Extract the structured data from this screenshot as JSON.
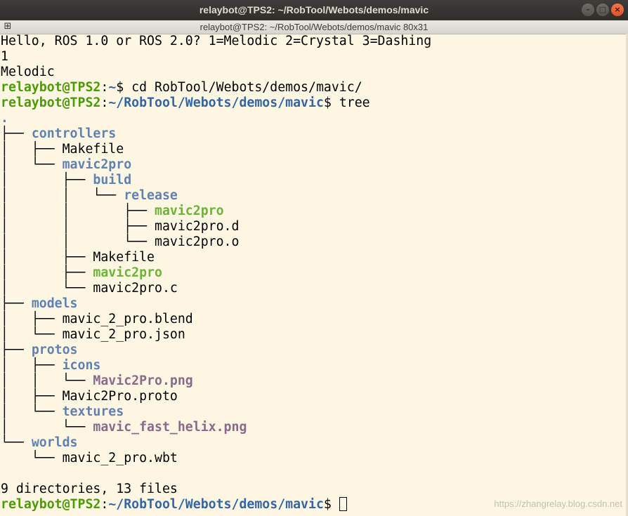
{
  "window": {
    "title": "relaybot@TPS2: ~/RobTool/Webots/demos/mavic",
    "tab_title": "relaybot@TPS2: ~/RobTool/Webots/demos/mavic 80x31",
    "minimize_glyph": "–",
    "maximize_glyph": "□",
    "close_glyph": "×"
  },
  "colors": {
    "background": "#fdf6e3",
    "prompt_user": "#4e9a06",
    "prompt_path": "#3465a4",
    "directory": "#5f81b3",
    "executable": "#6eb23a",
    "image_file": "#8a6a8a"
  },
  "terminal": {
    "lines": [
      [
        {
          "t": "Hello, ROS 1.0 or ROS 2.0? 1=Melodic 2=Crystal 3=Dashing",
          "c": ""
        }
      ],
      [
        {
          "t": "1",
          "c": ""
        }
      ],
      [
        {
          "t": "Melodic",
          "c": ""
        }
      ],
      [
        {
          "t": "relaybot@TPS2",
          "c": "prompt-user"
        },
        {
          "t": ":",
          "c": ""
        },
        {
          "t": "~",
          "c": "prompt-path"
        },
        {
          "t": "$ cd RobTool/Webots/demos/mavic/",
          "c": ""
        }
      ],
      [
        {
          "t": "relaybot@TPS2",
          "c": "prompt-user"
        },
        {
          "t": ":",
          "c": ""
        },
        {
          "t": "~/RobTool/Webots/demos/mavic",
          "c": "prompt-path"
        },
        {
          "t": "$ tree",
          "c": ""
        }
      ],
      [
        {
          "t": ".",
          "c": "dir"
        }
      ],
      [
        {
          "t": "├── ",
          "c": "tree-pre"
        },
        {
          "t": "controllers",
          "c": "dir"
        }
      ],
      [
        {
          "t": "│   ├── ",
          "c": "tree-pre"
        },
        {
          "t": "Makefile",
          "c": ""
        }
      ],
      [
        {
          "t": "│   └── ",
          "c": "tree-pre"
        },
        {
          "t": "mavic2pro",
          "c": "dir"
        }
      ],
      [
        {
          "t": "│       ├── ",
          "c": "tree-pre"
        },
        {
          "t": "build",
          "c": "dir"
        }
      ],
      [
        {
          "t": "│       │   └── ",
          "c": "tree-pre"
        },
        {
          "t": "release",
          "c": "dir"
        }
      ],
      [
        {
          "t": "│       │       ├── ",
          "c": "tree-pre"
        },
        {
          "t": "mavic2pro",
          "c": "exe"
        }
      ],
      [
        {
          "t": "│       │       ├── ",
          "c": "tree-pre"
        },
        {
          "t": "mavic2pro.d",
          "c": ""
        }
      ],
      [
        {
          "t": "│       │       └── ",
          "c": "tree-pre"
        },
        {
          "t": "mavic2pro.o",
          "c": ""
        }
      ],
      [
        {
          "t": "│       ├── ",
          "c": "tree-pre"
        },
        {
          "t": "Makefile",
          "c": ""
        }
      ],
      [
        {
          "t": "│       ├── ",
          "c": "tree-pre"
        },
        {
          "t": "mavic2pro",
          "c": "exe"
        }
      ],
      [
        {
          "t": "│       └── ",
          "c": "tree-pre"
        },
        {
          "t": "mavic2pro.c",
          "c": ""
        }
      ],
      [
        {
          "t": "├── ",
          "c": "tree-pre"
        },
        {
          "t": "models",
          "c": "dir"
        }
      ],
      [
        {
          "t": "│   ├── ",
          "c": "tree-pre"
        },
        {
          "t": "mavic_2_pro.blend",
          "c": ""
        }
      ],
      [
        {
          "t": "│   └── ",
          "c": "tree-pre"
        },
        {
          "t": "mavic_2_pro.json",
          "c": ""
        }
      ],
      [
        {
          "t": "├── ",
          "c": "tree-pre"
        },
        {
          "t": "protos",
          "c": "dir"
        }
      ],
      [
        {
          "t": "│   ├── ",
          "c": "tree-pre"
        },
        {
          "t": "icons",
          "c": "dir"
        }
      ],
      [
        {
          "t": "│   │   └── ",
          "c": "tree-pre"
        },
        {
          "t": "Mavic2Pro.png",
          "c": "img"
        }
      ],
      [
        {
          "t": "│   ├── ",
          "c": "tree-pre"
        },
        {
          "t": "Mavic2Pro.proto",
          "c": ""
        }
      ],
      [
        {
          "t": "│   └── ",
          "c": "tree-pre"
        },
        {
          "t": "textures",
          "c": "dir"
        }
      ],
      [
        {
          "t": "│       └── ",
          "c": "tree-pre"
        },
        {
          "t": "mavic_fast_helix.png",
          "c": "img"
        }
      ],
      [
        {
          "t": "└── ",
          "c": "tree-pre"
        },
        {
          "t": "worlds",
          "c": "dir"
        }
      ],
      [
        {
          "t": "    └── ",
          "c": "tree-pre"
        },
        {
          "t": "mavic_2_pro.wbt",
          "c": ""
        }
      ],
      [
        {
          "t": "",
          "c": ""
        }
      ],
      [
        {
          "t": "9 directories, 13 files",
          "c": ""
        }
      ],
      [
        {
          "t": "relaybot@TPS2",
          "c": "prompt-user"
        },
        {
          "t": ":",
          "c": ""
        },
        {
          "t": "~/RobTool/Webots/demos/mavic",
          "c": "prompt-path"
        },
        {
          "t": "$ ",
          "c": ""
        },
        {
          "t": "",
          "c": "cursor"
        }
      ]
    ]
  },
  "watermark": "https://zhangrelay.blog.csdn.net"
}
